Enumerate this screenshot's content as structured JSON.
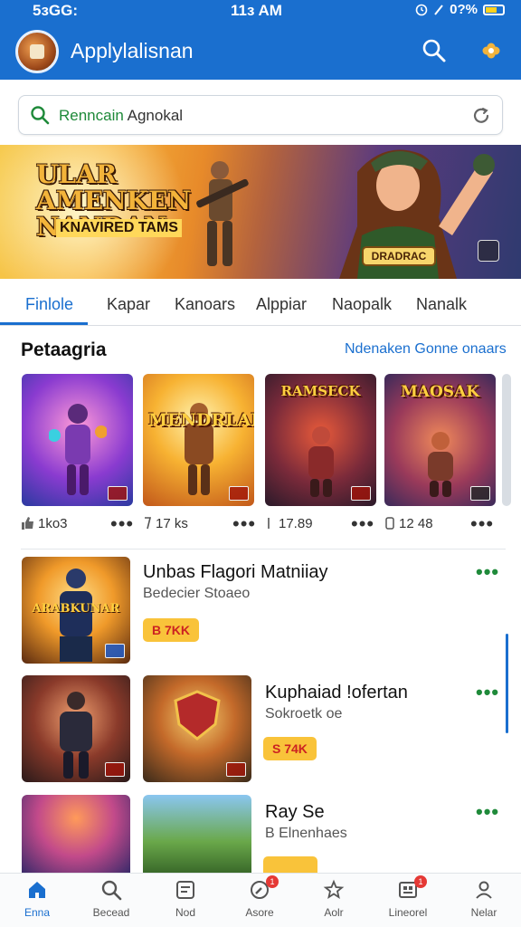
{
  "status_bar": {
    "left": "5ᴈGG:",
    "time": "11ᴈ AM",
    "battery": "0?%"
  },
  "app_bar": {
    "title": "Applylalisnan",
    "icons": [
      "search-icon",
      "gear-icon"
    ]
  },
  "search": {
    "placeholder_green": "Renncain",
    "placeholder_rest": " Agnokal"
  },
  "banner": {
    "title": "ULAR AMENKEN NANDAN",
    "subtitle": "KNAVIRED TAMS",
    "badge": "DRADRAC"
  },
  "tabs": [
    "Finlole",
    "Kapar",
    "Kanoars",
    "Alppiar",
    "Naopalk",
    "Nanalk"
  ],
  "section": {
    "title": "Petaagria",
    "link": "Ndenaken Gonne onaars"
  },
  "cards": [
    {
      "name": "",
      "stat": "1ko3"
    },
    {
      "name": "MENDRLAN",
      "stat": "17 ks"
    },
    {
      "name": "RAMSECK",
      "stat": "17.89"
    },
    {
      "name": "MAOSAK",
      "stat": "12 48"
    }
  ],
  "list": [
    {
      "title": "Unbas Flagori Matniiay",
      "subtitle": "Bedecier Stoaeo",
      "price": "B 7KK"
    },
    {
      "title": "Kuphaiad !ofertan",
      "subtitle": "Sokroetk oe",
      "price": "S 74K"
    },
    {
      "title": "Ray Se",
      "subtitle": "B Elnenhaes",
      "price": ""
    }
  ],
  "nav": [
    {
      "label": "Enna",
      "icon": "home-icon",
      "badge": ""
    },
    {
      "label": "Becead",
      "icon": "search-icon",
      "badge": ""
    },
    {
      "label": "Nod",
      "icon": "games-icon",
      "badge": ""
    },
    {
      "label": "Asore",
      "icon": "compass-icon",
      "badge": "1"
    },
    {
      "label": "Aolr",
      "icon": "star-icon",
      "badge": ""
    },
    {
      "label": "Lineorel",
      "icon": "library-icon",
      "badge": "1"
    },
    {
      "label": "Nelar",
      "icon": "profile-icon",
      "badge": ""
    }
  ],
  "colors": {
    "primary": "#1a6fcf",
    "accent_green": "#1f8a3a",
    "price_bg": "#f9c33a"
  }
}
